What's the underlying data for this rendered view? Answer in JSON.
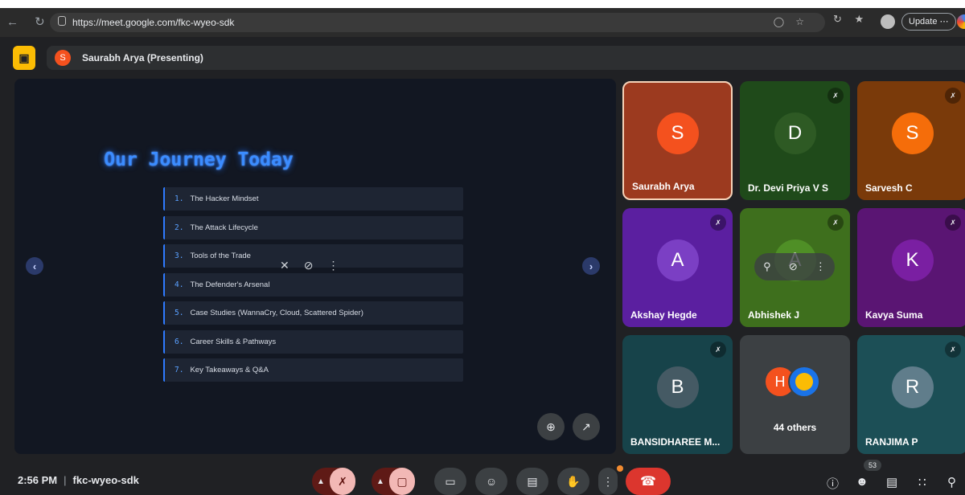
{
  "browser": {
    "url": "https://meet.google.com/fkc-wyeo-sdk",
    "update_label": "Update",
    "update_more": "⋯"
  },
  "meet": {
    "presenting_avatar_letter": "S",
    "presenting_label": "Saurabh Arya (Presenting)"
  },
  "slide": {
    "title": "Our Journey Today",
    "items": [
      {
        "num": "1.",
        "text": "The Hacker Mindset"
      },
      {
        "num": "2.",
        "text": "The Attack Lifecycle"
      },
      {
        "num": "3.",
        "text": "Tools of the Trade"
      },
      {
        "num": "4.",
        "text": "The Defender's Arsenal"
      },
      {
        "num": "5.",
        "text": "Case Studies (WannaCry, Cloud, Scattered Spider)"
      },
      {
        "num": "6.",
        "text": "Career Skills & Pathways"
      },
      {
        "num": "7.",
        "text": "Key Takeaways & Q&A"
      }
    ]
  },
  "participants": [
    {
      "letter": "S",
      "name": "Saurabh Arya",
      "bg": "#9c3a1f",
      "circle": "#f4511e"
    },
    {
      "letter": "D",
      "name": "Dr. Devi Priya V S",
      "bg": "#1f4a1a",
      "circle": "#2e5a24"
    },
    {
      "letter": "S",
      "name": "Sarvesh C",
      "bg": "#7a3a0a",
      "circle": "#f56d0a"
    },
    {
      "letter": "A",
      "name": "Akshay Hegde",
      "bg": "#5b1fa0",
      "circle": "#7b3fc4"
    },
    {
      "letter": "A",
      "name": "Abhishek J",
      "bg": "#3e6f1d",
      "circle": "#4f8f26"
    },
    {
      "letter": "K",
      "name": "Kavya Suma",
      "bg": "#5a1573",
      "circle": "#7a1fa2"
    },
    {
      "letter": "B",
      "name": "BANSIDHAREE M...",
      "bg": "#17434a",
      "circle": "#455a64"
    },
    {
      "letter": "R",
      "name": "RANJIMA P",
      "bg": "#1c4f56",
      "circle": "#607d8b"
    }
  ],
  "others": {
    "avatar_letter": "H",
    "label": "44 others"
  },
  "bottom": {
    "time": "2:56 PM",
    "separator": "|",
    "meeting_code": "fkc-wyeo-sdk",
    "people_count": "53"
  }
}
